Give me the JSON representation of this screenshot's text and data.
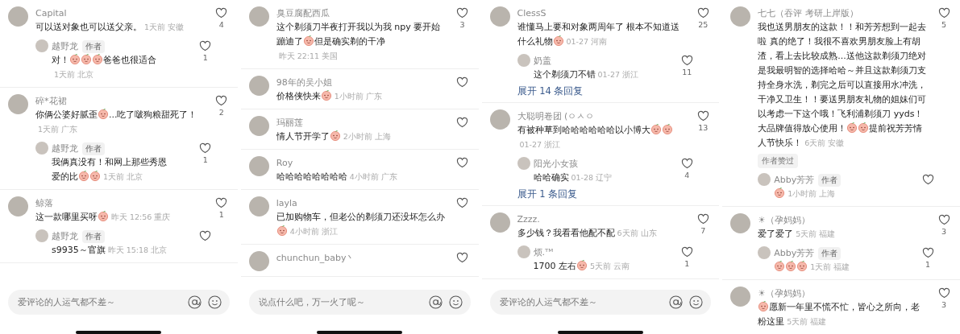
{
  "panels": [
    {
      "comments": [
        {
          "name": "Capital",
          "content": [
            {
              "kind": "text",
              "text": "可以送对象也可以送父亲。"
            }
          ],
          "meta": "1天前 安徽",
          "likes": "4",
          "replies": [
            {
              "name": "越野龙",
              "badge": "作者",
              "content": [
                {
                  "kind": "text",
                  "text": "对！"
                },
                {
                  "kind": "sticker"
                },
                {
                  "kind": "sticker"
                },
                {
                  "kind": "sticker"
                },
                {
                  "kind": "text",
                  "text": "爸爸也很适合"
                }
              ],
              "meta": "1天前 北京",
              "likes": "1"
            }
          ]
        },
        {
          "name": "碎*花裙",
          "content": [
            {
              "kind": "text",
              "text": "你俩公婆好腻歪"
            },
            {
              "kind": "sticker"
            },
            {
              "kind": "text",
              "text": "...吃了啵狗粮甜死了！"
            }
          ],
          "meta": "1天前 广东",
          "likes": "2",
          "replies": [
            {
              "name": "越野龙",
              "badge": "作者",
              "content": [
                {
                  "kind": "text",
                  "text": "我俩真没有！和网上那些秀恩爱的比"
                },
                {
                  "kind": "sticker"
                },
                {
                  "kind": "sticker"
                }
              ],
              "meta": "1天前 北京",
              "likes": "1"
            }
          ]
        },
        {
          "name": "鲸落",
          "content": [
            {
              "kind": "text",
              "text": "这一款哪里买呀"
            },
            {
              "kind": "sticker"
            }
          ],
          "meta": "昨天 12:56 重庆",
          "likes": "1",
          "replies": [
            {
              "name": "越野龙",
              "badge": "作者",
              "content": [
                {
                  "kind": "text",
                  "text": "s9935～官旗"
                }
              ],
              "meta": "昨天 15:18 北京"
            }
          ]
        }
      ],
      "input": {
        "placeholder": "爱评论的人运气都不差～"
      }
    },
    {
      "comments": [
        {
          "name": "臭豆腐配西瓜",
          "content": [
            {
              "kind": "text",
              "text": "这个剃须刀半夜打开我以为我 npy 要开始蹦迪了"
            },
            {
              "kind": "sticker"
            },
            {
              "kind": "text",
              "text": "但是确实剃的干净"
            }
          ],
          "meta": "昨天 22:11 美国",
          "likes": "3"
        },
        {
          "name": "98年的吴小姐",
          "content": [
            {
              "kind": "text",
              "text": "价格侠快来"
            },
            {
              "kind": "sticker"
            }
          ],
          "meta": "1小时前 广东"
        },
        {
          "name": "玛丽莲",
          "content": [
            {
              "kind": "text",
              "text": "情人节开学了"
            },
            {
              "kind": "sticker"
            }
          ],
          "meta": "2小时前 上海"
        },
        {
          "name": "Roy",
          "content": [
            {
              "kind": "text",
              "text": "哈哈哈哈哈哈哈哈"
            }
          ],
          "meta": "4小时前 广东"
        },
        {
          "name": "layla",
          "content": [
            {
              "kind": "text",
              "text": "已加购物车，但老公的剃须刀还没坏怎么办"
            },
            {
              "kind": "sticker"
            }
          ],
          "meta": "4小时前 浙江"
        },
        {
          "name": "chunchun_baby丶"
        }
      ],
      "input": {
        "placeholder": "说点什么吧，万一火了呢～"
      }
    },
    {
      "comments": [
        {
          "name": "ClessS",
          "content": [
            {
              "kind": "text",
              "text": "谁懂马上要和对象两周年了 根本不知道送什么礼物"
            },
            {
              "kind": "sticker"
            }
          ],
          "meta": "01-27 河南",
          "likes": "25",
          "replies": [
            {
              "name": "奶盖",
              "content": [
                {
                  "kind": "text",
                  "text": "这个剃须刀不错"
                }
              ],
              "meta": "01-27 浙江",
              "likes": "11"
            }
          ],
          "expand": "展开 14 条回复"
        },
        {
          "name": "大聪明卷团 (ㅇㅅㅇ",
          "content": [
            {
              "kind": "text",
              "text": "有被种草到哈哈哈哈哈哈以小博大"
            },
            {
              "kind": "sticker"
            },
            {
              "kind": "sticker"
            }
          ],
          "meta": "01-27 浙江",
          "likes": "13",
          "replies": [
            {
              "name": "阳光小女孩",
              "content": [
                {
                  "kind": "text",
                  "text": "哈哈确实"
                }
              ],
              "meta": "01-28 辽宁",
              "likes": "4"
            }
          ],
          "expand": "展开 1 条回复"
        },
        {
          "name": "Zzzz.",
          "content": [
            {
              "kind": "text",
              "text": "多少钱？我看看他配不配"
            }
          ],
          "meta": "6天前 山东",
          "likes": "7",
          "replies": [
            {
              "name": "烦.ᵀᴹ",
              "content": [
                {
                  "kind": "text",
                  "text": "1700 左右"
                },
                {
                  "kind": "sticker"
                }
              ],
              "meta": "5天前 云南",
              "likes": "1"
            }
          ]
        }
      ],
      "input": {
        "placeholder": "爱评论的人运气都不差～"
      }
    },
    {
      "comments": [
        {
          "name": "七七（吞评 考研上岸版）",
          "content": [
            {
              "kind": "text",
              "text": "我也送男朋友的这款！！和芳芳想到一起去啦 真的绝了！我很不喜欢男朋友脸上有胡渣，看上去比较成熟...送他这款剃须刀绝对是我最明智的选择哈哈～并且这款剃须刀支持全身水洗，剃完之后可以直接用水冲洗，干净又卫生！！要送男朋友礼物的姐妹们可以考虑一下这个哦！飞利浦剃须刀 yyds！大品牌值得放心使用！"
            },
            {
              "kind": "sticker"
            },
            {
              "kind": "sticker"
            },
            {
              "kind": "text",
              "text": "提前祝芳芳情人节快乐！"
            }
          ],
          "meta": "6天前 安徽",
          "likes": "5",
          "tag": "作者赞过",
          "replies": [
            {
              "name": "Abby芳芳",
              "badge": "作者",
              "content": [
                {
                  "kind": "sticker"
                }
              ],
              "meta": "1小时前 上海"
            }
          ]
        },
        {
          "name": "☀（孕妈妈）",
          "content": [
            {
              "kind": "text",
              "text": "爱了爱了"
            }
          ],
          "meta": "5天前 福建",
          "likes": "3",
          "replies": [
            {
              "name": "Abby芳芳",
              "badge": "作者",
              "content": [
                {
                  "kind": "sticker"
                },
                {
                  "kind": "sticker"
                },
                {
                  "kind": "sticker"
                }
              ],
              "meta": "1天前 福建",
              "likes": "1"
            }
          ]
        },
        {
          "name": "☀（孕妈妈）",
          "content": [
            {
              "kind": "sticker"
            },
            {
              "kind": "text",
              "text": "愿新一年里不慌不忙，皆心之所向，老粉这里"
            }
          ],
          "meta": "5天前 福建",
          "likes": "3"
        }
      ]
    }
  ]
}
